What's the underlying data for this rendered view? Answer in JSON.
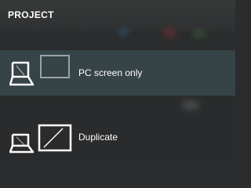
{
  "flyout": {
    "title": "PROJECT",
    "options": [
      {
        "label": "PC screen only",
        "icon": "pc-screen-only-icon",
        "selected": true
      },
      {
        "label": "Duplicate",
        "icon": "duplicate-icon",
        "selected": false
      }
    ]
  },
  "colors": {
    "background": "#2a2c2d",
    "text": "#ffffff",
    "dim_screen": "#9aa3a6"
  }
}
